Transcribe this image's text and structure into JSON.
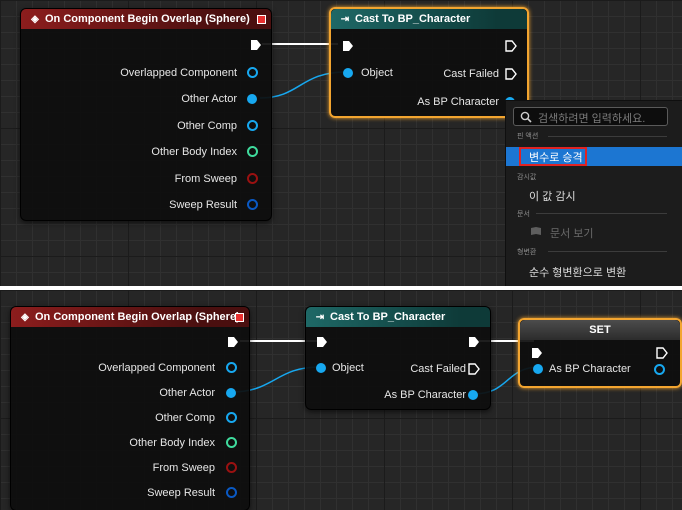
{
  "top_panel": {
    "event_node": {
      "title": "On Component Begin Overlap (Sphere)",
      "pins": [
        "Overlapped Component",
        "Other Actor",
        "Other Comp",
        "Other Body Index",
        "From Sweep",
        "Sweep Result"
      ]
    },
    "cast_node": {
      "title": "Cast To BP_Character",
      "input_object": "Object",
      "cast_failed": "Cast Failed",
      "as_bp_character": "As BP Character"
    },
    "context_menu": {
      "search_placeholder": "검색하려면 입력하세요.",
      "sections": [
        {
          "label": "핀 액션",
          "items": [
            {
              "label": "변수로 승격",
              "highlighted": true
            }
          ]
        },
        {
          "label": "감시값",
          "items": [
            {
              "label": "이 값 감시"
            }
          ]
        },
        {
          "label": "문서",
          "items": [
            {
              "label": "문서 보기",
              "disabled": true
            }
          ]
        },
        {
          "label": "형변환",
          "items": [
            {
              "label": "순수 형변환으로 변환"
            }
          ]
        }
      ]
    }
  },
  "bottom_panel": {
    "event_node": {
      "title": "On Component Begin Overlap (Sphere)",
      "pins": [
        "Overlapped Component",
        "Other Actor",
        "Other Comp",
        "Other Body Index",
        "From Sweep",
        "Sweep Result"
      ]
    },
    "cast_node": {
      "title": "Cast To BP_Character",
      "input_object": "Object",
      "cast_failed": "Cast Failed",
      "as_bp_character": "As BP Character"
    },
    "set_node": {
      "title": "SET",
      "input_pin": "As BP Character"
    }
  },
  "colors": {
    "object_pin": "#17a8f0",
    "int_pin": "#3fdb9d",
    "bool_pin": "#9a1111",
    "struct_pin": "#0a59c4",
    "selection": "#f3a530",
    "menu_highlight": "#1c76d2"
  }
}
